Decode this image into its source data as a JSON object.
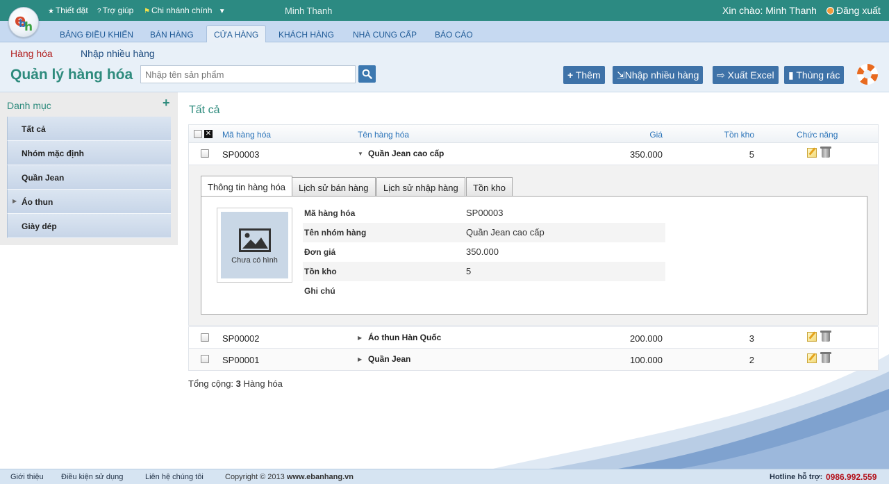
{
  "topbar": {
    "settings": "Thiết đặt",
    "help": "Trợ giúp",
    "branch": "Chi nhánh chính",
    "user_center": "Minh Thanh",
    "greeting": "Xin chào: Minh Thanh",
    "logout": "Đăng xuất"
  },
  "nav": {
    "tabs": [
      "Bảng điều khiển",
      "Bán hàng",
      "Cửa hàng",
      "Khách hàng",
      "Nhà cung cấp",
      "Báo cáo"
    ],
    "active": "Cửa hàng"
  },
  "subnav": {
    "tabs": [
      "Hàng hóa",
      "Nhập nhiều hàng"
    ]
  },
  "header": {
    "title": "Quản lý hàng hóa",
    "search_placeholder": "Nhập tên sản phẩm",
    "buttons": {
      "add": "Thêm",
      "import": "Nhập nhiều hàng",
      "export": "Xuất Excel",
      "trash": "Thùng rác"
    }
  },
  "sidebar": {
    "title": "Danh mục",
    "add_symbol": "+",
    "items": [
      "Tất cả",
      "Nhóm mặc định",
      "Quần Jean",
      "Áo thun",
      "Giày dép"
    ]
  },
  "main": {
    "section_title": "Tất cả",
    "columns": {
      "code": "Mã hàng hóa",
      "name": "Tên hàng hóa",
      "price": "Giá",
      "stock": "Tồn kho",
      "actions": "Chức năng"
    },
    "rows": [
      {
        "code": "SP00003",
        "name": "Quần Jean cao cấp",
        "price": "350.000",
        "stock": "5",
        "expanded": true
      },
      {
        "code": "SP00002",
        "name": "Áo thun Hàn Quốc",
        "price": "200.000",
        "stock": "3",
        "expanded": false
      },
      {
        "code": "SP00001",
        "name": "Quần Jean",
        "price": "100.000",
        "stock": "2",
        "expanded": false
      }
    ],
    "detail": {
      "tabs": [
        "Thông tin hàng hóa",
        "Lịch sử bán hàng",
        "Lịch sử nhập hàng",
        "Tồn kho"
      ],
      "no_image": "Chưa có hình",
      "fields": [
        {
          "label": "Mã hàng hóa",
          "value": "SP00003"
        },
        {
          "label": "Tên nhóm hàng",
          "value": "Quần Jean cao cấp"
        },
        {
          "label": "Đơn giá",
          "value": "350.000"
        },
        {
          "label": "Tồn kho",
          "value": "5"
        },
        {
          "label": "Ghi chú",
          "value": ""
        }
      ]
    },
    "total_prefix": "Tổng cộng:",
    "total_count": "3",
    "total_suffix": "Hàng hóa"
  },
  "footer": {
    "links": [
      "Giới thiệu",
      "Điều kiện sử dụng",
      "Liên hệ chúng tôi"
    ],
    "copyright_prefix": "Copyright © 2013",
    "copyright_site": "www.ebanhang.vn",
    "hotline_label": "Hotline hỗ trợ:",
    "hotline": "0986.992.559"
  },
  "colors": {
    "topbar": "#2c8a82",
    "accent_teal": "#2e8b7d",
    "button_blue": "#3e72a8",
    "active_subtab": "#b22222",
    "hotline": "#b3121b"
  }
}
